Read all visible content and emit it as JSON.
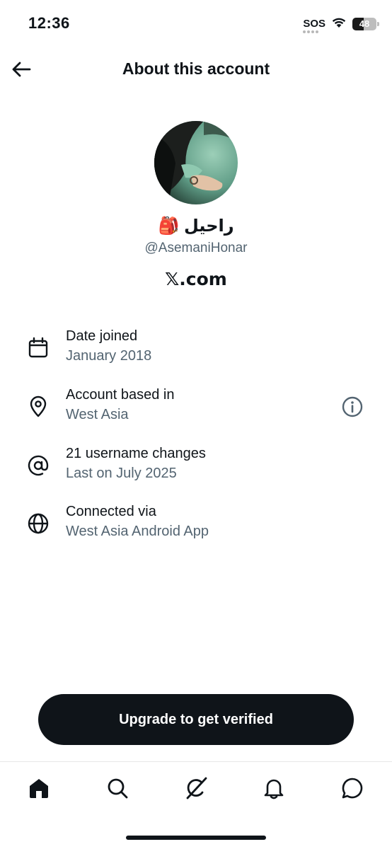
{
  "status_bar": {
    "time": "12:36",
    "carrier": "SOS",
    "battery_level": "48",
    "icons": [
      "wifi-icon",
      "battery-icon"
    ]
  },
  "header": {
    "title": "About this account",
    "back_icon": "arrow-left-icon"
  },
  "profile": {
    "display_name": "راحیل 🎒",
    "username": "@AsemaniHonar",
    "site": "𝕏.com"
  },
  "info_rows": [
    {
      "icon": "calendar-icon",
      "title": "Date joined",
      "subtitle": "January 2018"
    },
    {
      "icon": "location-pin-icon",
      "title": "Account based in",
      "subtitle": "West Asia",
      "trailing_icon": "info-icon"
    },
    {
      "icon": "at-sign-icon",
      "title": "21 username changes",
      "subtitle": "Last on July 2025"
    },
    {
      "icon": "globe-icon",
      "title": "Connected via",
      "subtitle": "West Asia Android App"
    }
  ],
  "cta": {
    "label": "Upgrade to get verified"
  },
  "tab_bar": {
    "items": [
      "home-icon",
      "search-icon",
      "grok-icon",
      "bell-icon",
      "messages-icon"
    ],
    "active": "home-icon"
  },
  "colors": {
    "text_primary": "#0f1419",
    "text_secondary": "#536471",
    "button_bg": "#0f1419",
    "background": "#ffffff"
  }
}
